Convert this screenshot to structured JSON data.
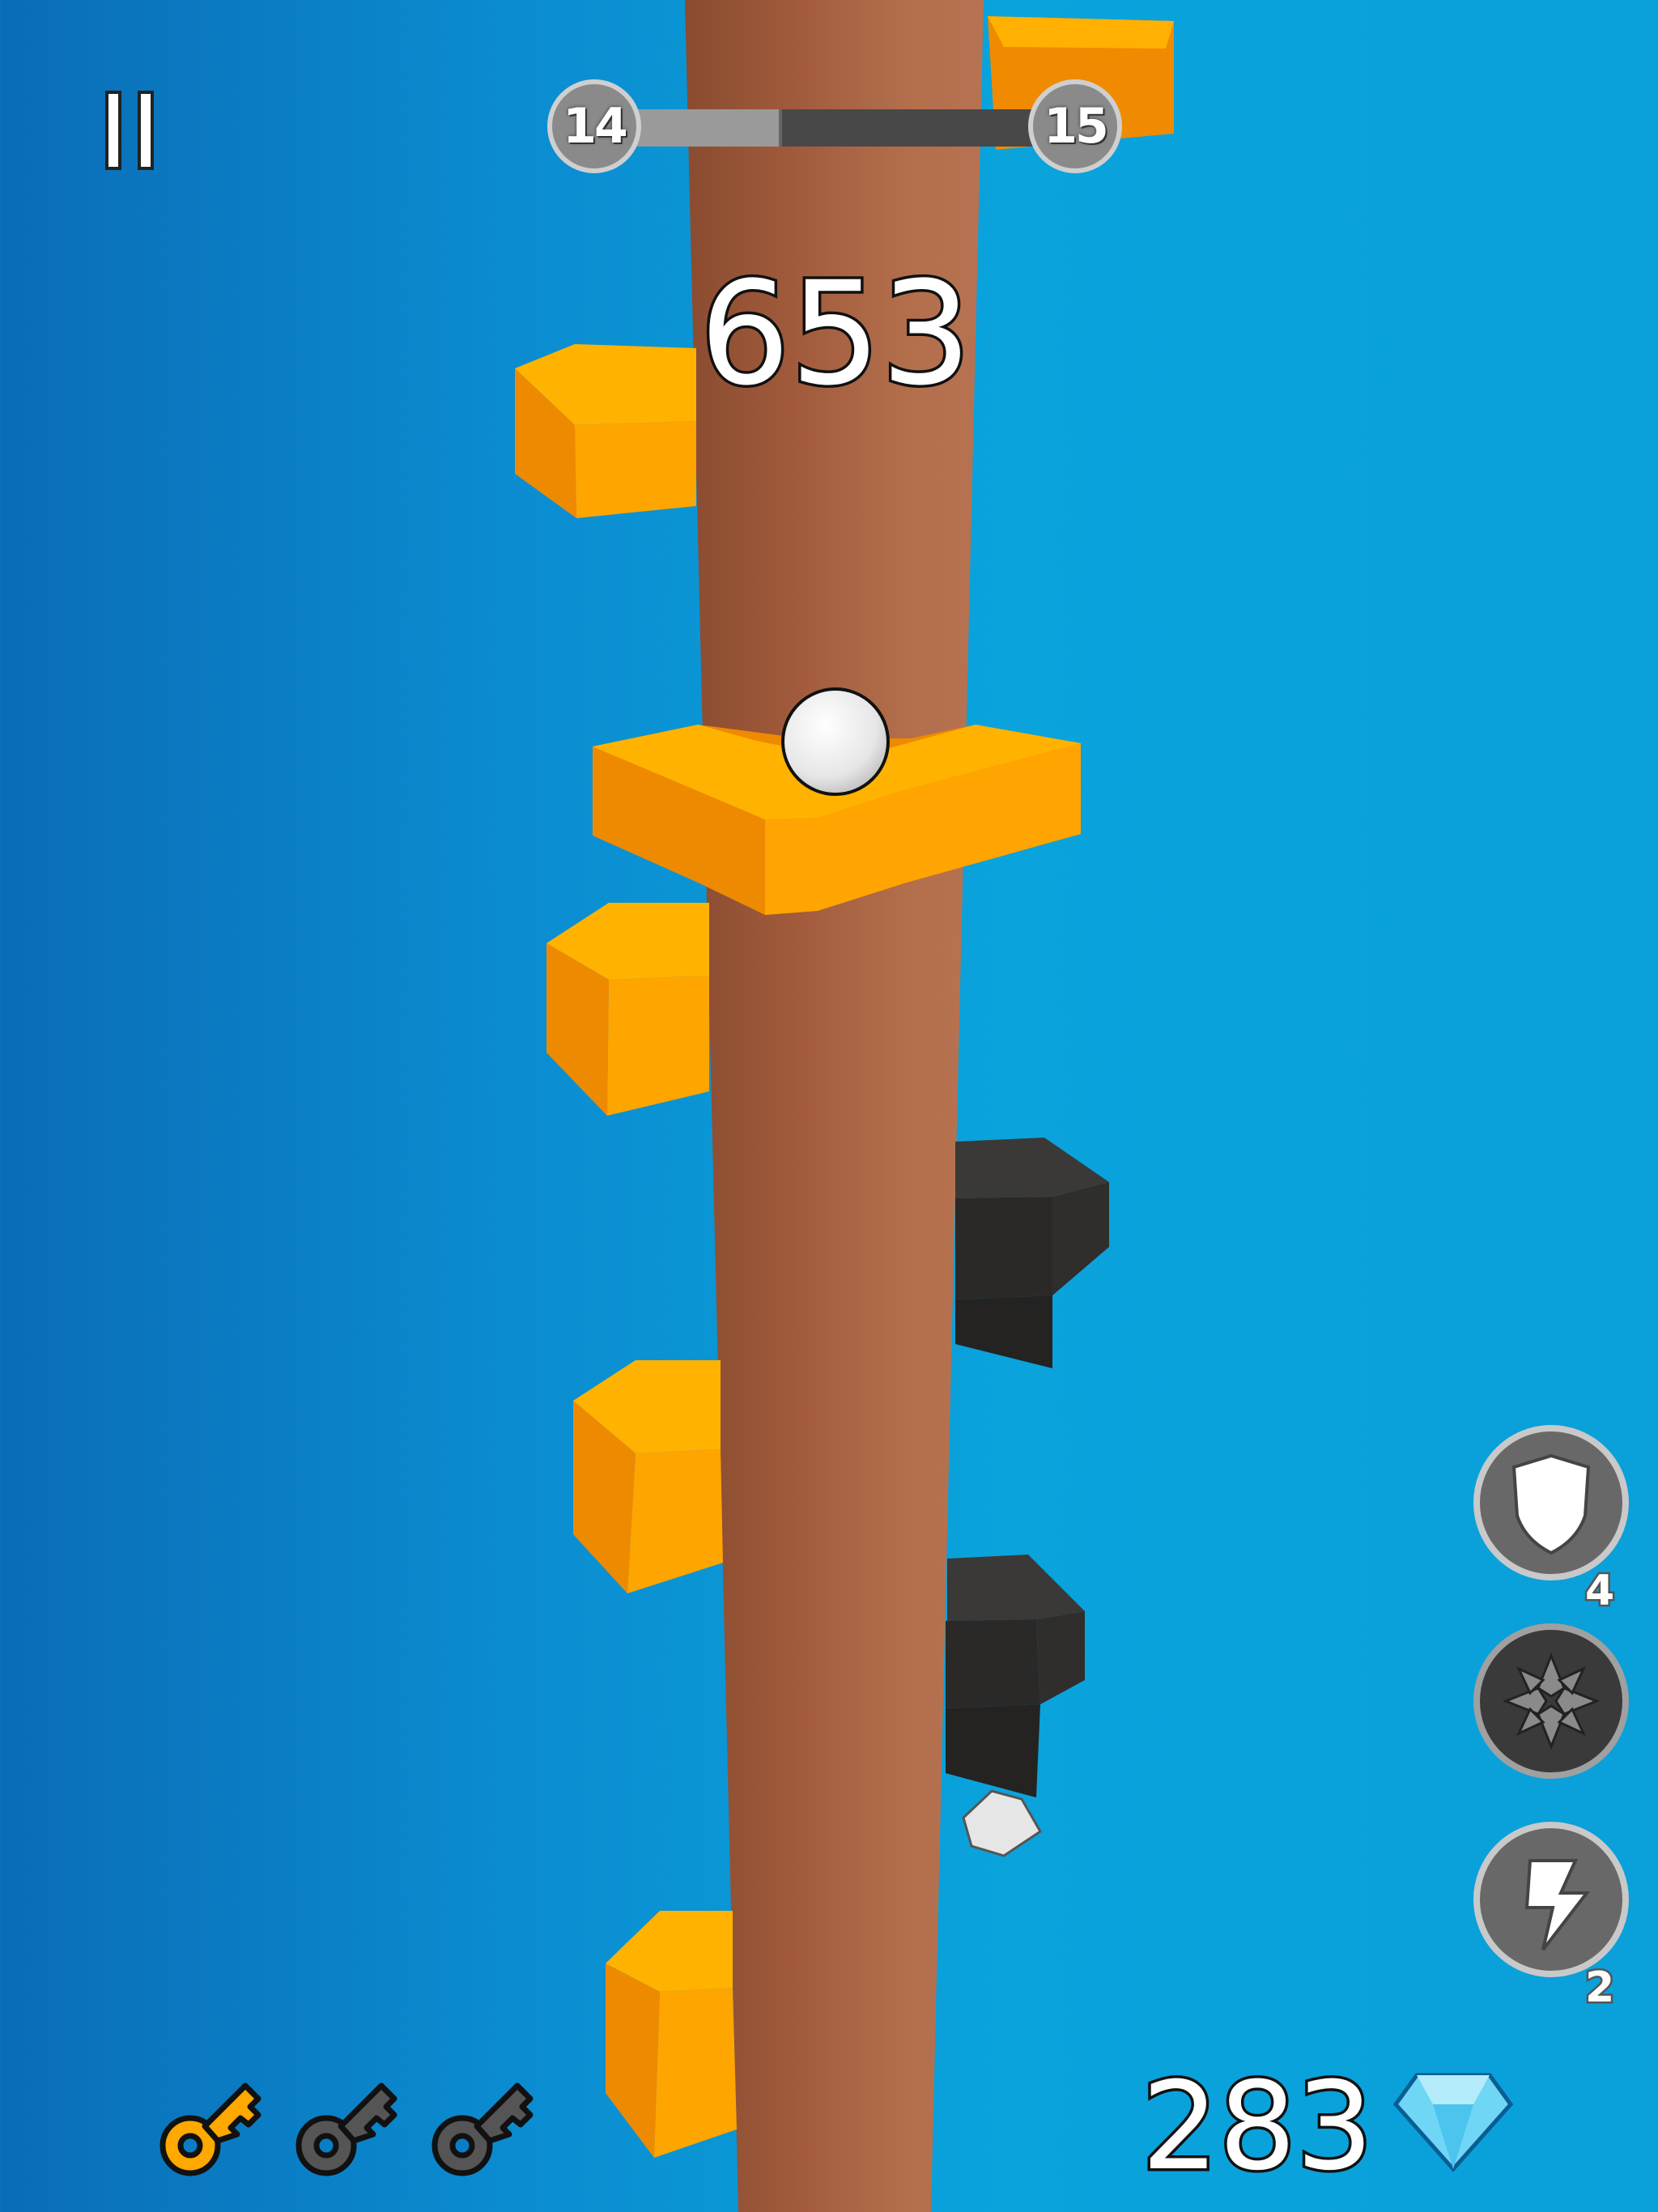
{
  "level": {
    "current": "14",
    "next": "15",
    "progress": 0.39
  },
  "score": "653",
  "powerups": {
    "shield": {
      "icon": "shield-icon",
      "count": "4"
    },
    "burst": {
      "icon": "burst-icon"
    },
    "bolt": {
      "icon": "lightning-bolt-icon",
      "count": "2"
    }
  },
  "keys": {
    "collected": 1,
    "total": 3
  },
  "gems": "283",
  "colors": {
    "background": "#0a8fd0",
    "pole": "#a5613f",
    "platform": "#ffae00",
    "hazard": "#2b2a29",
    "ball": "#eaeaea",
    "key_collected": "#ffa800",
    "key_empty": "#555555",
    "gem": "#6fd6f5"
  }
}
